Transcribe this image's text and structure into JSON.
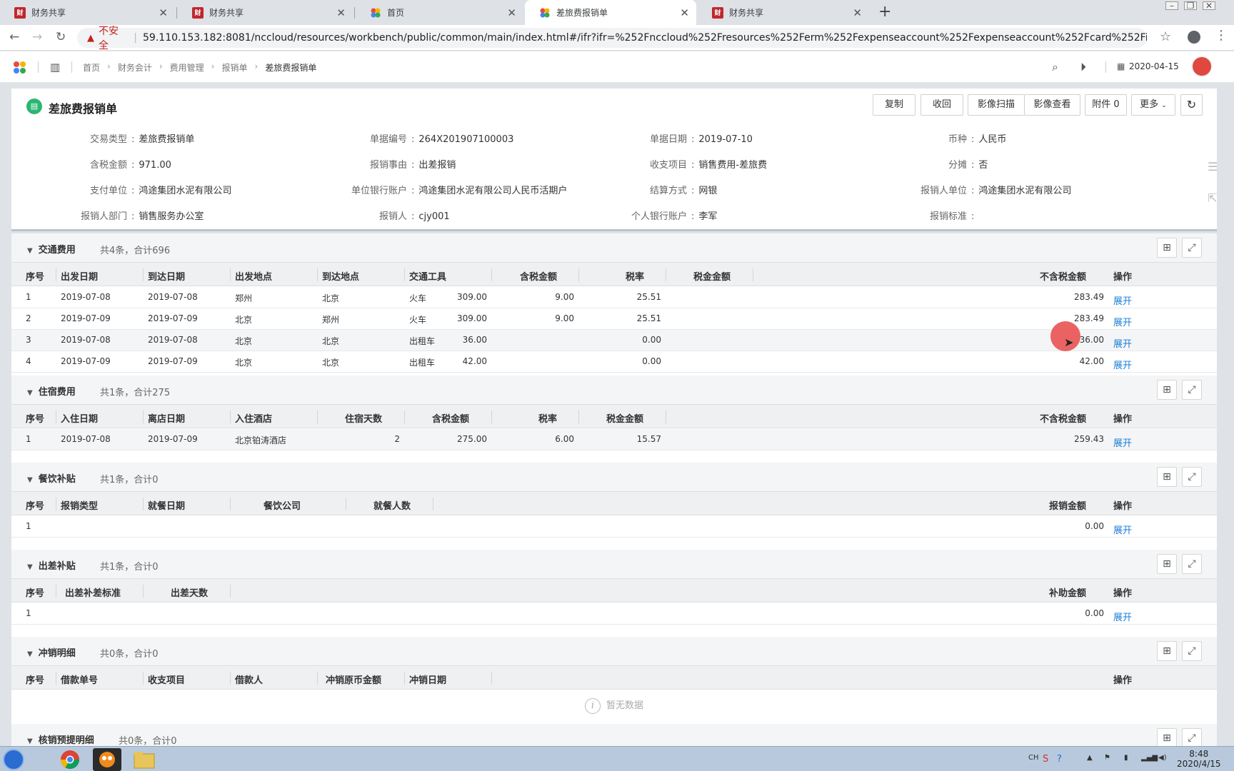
{
  "browser": {
    "tabs": [
      {
        "label": "财务共享",
        "icon": "red-app-icon",
        "active": false
      },
      {
        "label": "财务共享",
        "icon": "red-app-icon",
        "active": false
      },
      {
        "label": "首页",
        "icon": "nccloud-icon",
        "active": false
      },
      {
        "label": "差旅费报销单",
        "icon": "nccloud-icon",
        "active": true
      },
      {
        "label": "财务共享",
        "icon": "red-app-icon",
        "active": false
      }
    ],
    "insecure_label": "不安全",
    "url": "59.110.153.182:8081/nccloud/resources/workbench/public/common/main/index.html#/ifr?ifr=%252Fnccloud%252Fresources%252Ferm%252Fexpenseaccount%252Fexpenseaccount%252Fcard%252Findex...."
  },
  "appbar": {
    "breadcrumb": [
      "首页",
      "财务会计",
      "费用管理",
      "报销单",
      "差旅费报销单"
    ],
    "date": "2020-04-15"
  },
  "header": {
    "title": "差旅费报销单",
    "buttons": {
      "copy": "复制",
      "recall": "收回",
      "scan": "影像扫描",
      "view": "影像查看",
      "attach": "附件 0",
      "more": "更多"
    },
    "fields": [
      {
        "label": "交易类型",
        "value": "差旅费报销单"
      },
      {
        "label": "单据编号",
        "value": "264X201907100003"
      },
      {
        "label": "单据日期",
        "value": "2019-07-10"
      },
      {
        "label": "币种",
        "value": "人民币"
      },
      {
        "label": "含税金额",
        "value": "971.00"
      },
      {
        "label": "报销事由",
        "value": "出差报销"
      },
      {
        "label": "收支项目",
        "value": "销售费用-差旅费"
      },
      {
        "label": "分摊",
        "value": "否"
      },
      {
        "label": "支付单位",
        "value": "鸿途集团水泥有限公司"
      },
      {
        "label": "单位银行账户",
        "value": "鸿途集团水泥有限公司人民币活期户"
      },
      {
        "label": "结算方式",
        "value": "网银"
      },
      {
        "label": "报销人单位",
        "value": "鸿途集团水泥有限公司"
      },
      {
        "label": "报销人部门",
        "value": "销售服务办公室"
      },
      {
        "label": "报销人",
        "value": "cjy001"
      },
      {
        "label": "个人银行账户",
        "value": "李军"
      },
      {
        "label": "报销标准",
        "value": ""
      }
    ]
  },
  "expand_label": "展开",
  "sections": {
    "transport": {
      "title": "交通费用",
      "summary": "共4条，合计696",
      "columns": [
        "序号",
        "出发日期",
        "到达日期",
        "出发地点",
        "到达地点",
        "交通工具",
        "含税金额",
        "税率",
        "税金金额",
        "不含税金额",
        "操作"
      ],
      "rows": [
        [
          "1",
          "2019-07-08",
          "2019-07-08",
          "郑州",
          "北京",
          "火车",
          "309.00",
          "9.00",
          "25.51",
          "283.49"
        ],
        [
          "2",
          "2019-07-09",
          "2019-07-09",
          "北京",
          "郑州",
          "火车",
          "309.00",
          "9.00",
          "25.51",
          "283.49"
        ],
        [
          "3",
          "2019-07-08",
          "2019-07-08",
          "北京",
          "北京",
          "出租车",
          "36.00",
          "",
          "0.00",
          "36.00"
        ],
        [
          "4",
          "2019-07-09",
          "2019-07-09",
          "北京",
          "北京",
          "出租车",
          "42.00",
          "",
          "0.00",
          "42.00"
        ]
      ]
    },
    "lodging": {
      "title": "住宿费用",
      "summary": "共1条，合计275",
      "columns": [
        "序号",
        "入住日期",
        "离店日期",
        "入住酒店",
        "住宿天数",
        "含税金额",
        "税率",
        "税金金额",
        "不含税金额",
        "操作"
      ],
      "rows": [
        [
          "1",
          "2019-07-08",
          "2019-07-09",
          "北京铂涛酒店",
          "2",
          "275.00",
          "6.00",
          "15.57",
          "259.43"
        ]
      ]
    },
    "meal": {
      "title": "餐饮补贴",
      "summary": "共1条，合计0",
      "columns": [
        "序号",
        "报销类型",
        "就餐日期",
        "餐饮公司",
        "就餐人数",
        "报销金额",
        "操作"
      ],
      "rows": [
        [
          "1",
          "0.00"
        ]
      ]
    },
    "travel_allowance": {
      "title": "出差补贴",
      "summary": "共1条，合计0",
      "columns": [
        "序号",
        "出差补差标准",
        "出差天数",
        "补助金额",
        "操作"
      ],
      "rows": [
        [
          "1",
          "0.00"
        ]
      ]
    },
    "offset": {
      "title": "冲销明细",
      "summary": "共0条，合计0",
      "columns": [
        "序号",
        "借款单号",
        "收支项目",
        "借款人",
        "冲销原币金额",
        "冲销日期",
        "操作"
      ],
      "empty_text": "暂无数据"
    },
    "verify": {
      "title": "核销预提明细",
      "summary": "共0条，合计0"
    }
  },
  "taskbar": {
    "time": "8:48",
    "date": "2020/4/15",
    "ime": "CH"
  }
}
